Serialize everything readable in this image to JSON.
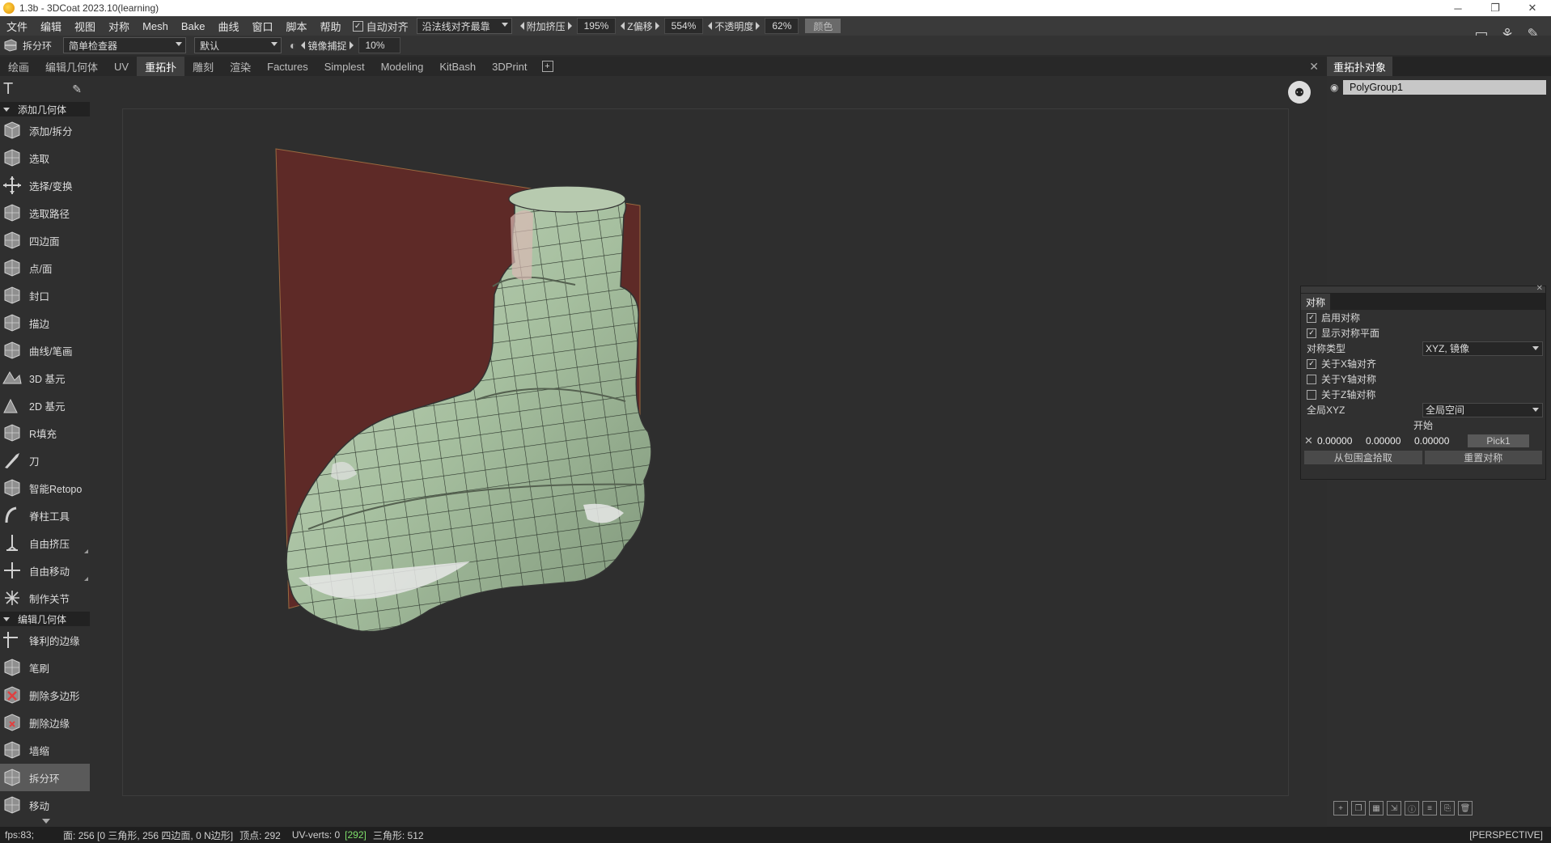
{
  "window": {
    "title": "1.3b - 3DCoat 2023.10(learning)",
    "min": "─",
    "max": "❐",
    "close": "✕"
  },
  "menu": {
    "items": [
      "文件",
      "编辑",
      "视图",
      "对称",
      "Mesh",
      "Bake",
      "曲线",
      "窗口",
      "脚本",
      "帮助"
    ],
    "auto_align_label": "自动对齐",
    "align_mode": "沿法线对齐最靠",
    "extrude_label": "附加挤压",
    "extrude_value": "195%",
    "zoffset_label": "Z偏移",
    "zoffset_value": "554%",
    "opacity_label": "不透明度",
    "opacity_value": "62%",
    "color_label": "颜色"
  },
  "toolbar2": {
    "current_tool": "拆分环",
    "checker": "简单检查器",
    "preset": "默认",
    "mirror_label": "镜像捕捉",
    "mirror_value": "10%"
  },
  "tabs": [
    "绘画",
    "编辑几何体",
    "UV",
    "重拓扑",
    "雕刻",
    "渲染",
    "Factures",
    "Simplest",
    "Modeling",
    "KitBash",
    "3DPrint"
  ],
  "active_tab": "重拓扑",
  "left_panel": {
    "section1": "添加几何体",
    "tools1": [
      {
        "label": "添加/拆分",
        "icon": "cube-icon"
      },
      {
        "label": "选取",
        "icon": "select-cube-icon"
      },
      {
        "label": "选择/变换",
        "icon": "move-arrows-icon"
      },
      {
        "label": "选取路径",
        "icon": "path-icon"
      },
      {
        "label": "四边面",
        "icon": "quad-icon"
      },
      {
        "label": "点/面",
        "icon": "point-face-icon"
      },
      {
        "label": "封口",
        "icon": "cap-icon"
      },
      {
        "label": "描边",
        "icon": "stroke-icon"
      },
      {
        "label": "曲线/笔画",
        "icon": "curve-icon"
      },
      {
        "label": "3D 基元",
        "icon": "primitive-3d-icon"
      },
      {
        "label": "2D 基元",
        "icon": "primitive-2d-icon"
      },
      {
        "label": "R填充",
        "icon": "fill-icon"
      },
      {
        "label": "刀",
        "icon": "knife-icon"
      },
      {
        "label": "智能Retopo",
        "icon": "smart-retopo-icon"
      },
      {
        "label": "脊柱工具",
        "icon": "spine-icon"
      },
      {
        "label": "自由挤压",
        "icon": "extrude-icon"
      },
      {
        "label": "自由移动",
        "icon": "free-move-icon"
      },
      {
        "label": "制作关节",
        "icon": "joint-icon"
      }
    ],
    "section2": "编辑几何体",
    "tools2": [
      {
        "label": "锋利的边缘",
        "icon": "sharp-edge-icon"
      },
      {
        "label": "笔刷",
        "icon": "brush-cube-icon"
      },
      {
        "label": "删除多边形",
        "icon": "delete-poly-icon"
      },
      {
        "label": "删除边缘",
        "icon": "delete-edge-icon"
      },
      {
        "label": "墙缩",
        "icon": "shrink-icon"
      },
      {
        "label": "拆分环",
        "icon": "split-ring-icon"
      },
      {
        "label": "移动",
        "icon": "move-cube-icon"
      }
    ]
  },
  "right_panel": {
    "tab": "重拓扑对象",
    "group": "PolyGroup1"
  },
  "symmetry": {
    "tab": "对称",
    "enable": "启用对称",
    "show_plane": "显示对称平面",
    "type_label": "对称类型",
    "type_value": "XYZ, 镜像",
    "x_label": "关于X轴对齐",
    "y_label": "关于Y轴对称",
    "z_label": "关于Z轴对称",
    "space_label": "全局XYZ",
    "space_value": "全局空间",
    "start_label": "开始",
    "x": "0.00000",
    "y": "0.00000",
    "z": "0.00000",
    "pick": "Pick1",
    "from_bbox": "从包围盒拾取",
    "reset": "重置对称"
  },
  "status": {
    "fps": "fps:83;",
    "faces_a": "面: 256 [0 三角形, 256 四边面, 0 N边形]",
    "verts": "顶点: 292",
    "uv_a": "UV-verts: 0",
    "uv_b": "[292]",
    "tris": "三角形: 512",
    "view": "[PERSPECTIVE]"
  },
  "colors": {
    "accent": "#3f3f3f",
    "mesh": "#a8c2a2",
    "plane": "#6b2a26"
  }
}
